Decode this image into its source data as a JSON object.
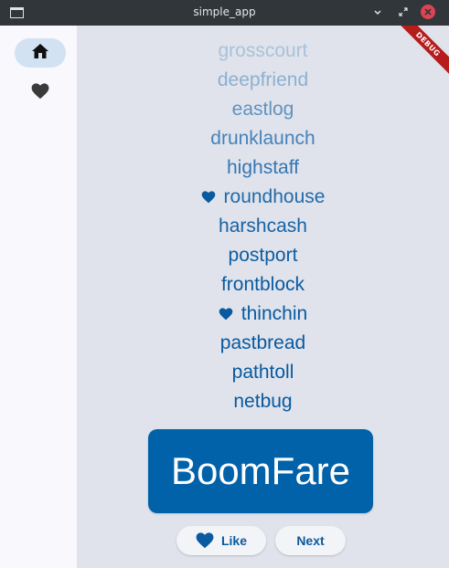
{
  "window": {
    "title": "simple_app"
  },
  "rail": {
    "items": [
      {
        "icon": "home-icon",
        "selected": true
      },
      {
        "icon": "heart-icon",
        "selected": false
      }
    ]
  },
  "history": {
    "items": [
      {
        "text": "grosscourt",
        "favorite": false,
        "color": "#a9c2da"
      },
      {
        "text": "deepfriend",
        "favorite": false,
        "color": "#8bb0d2"
      },
      {
        "text": "eastlog",
        "favorite": false,
        "color": "#5f92c0"
      },
      {
        "text": "drunklaunch",
        "favorite": false,
        "color": "#4682bb"
      },
      {
        "text": "highstaff",
        "favorite": false,
        "color": "#3476b3"
      },
      {
        "text": "roundhouse",
        "favorite": true,
        "color": "#236aa8"
      },
      {
        "text": "harshcash",
        "favorite": false,
        "color": "#1762a4"
      },
      {
        "text": "postport",
        "favorite": false,
        "color": "#0d5da2"
      },
      {
        "text": "frontblock",
        "favorite": false,
        "color": "#095ba0"
      },
      {
        "text": "thinchin",
        "favorite": true,
        "color": "#085aa0"
      },
      {
        "text": "pastbread",
        "favorite": false,
        "color": "#07599f"
      },
      {
        "text": "pathtoll",
        "favorite": false,
        "color": "#07599f"
      },
      {
        "text": "netbug",
        "favorite": false,
        "color": "#07599f"
      }
    ]
  },
  "card": {
    "word": "BoomFare",
    "background": "#0262a9"
  },
  "actions": {
    "like_label": "Like",
    "next_label": "Next"
  },
  "debug": {
    "label": "DEBUG"
  }
}
